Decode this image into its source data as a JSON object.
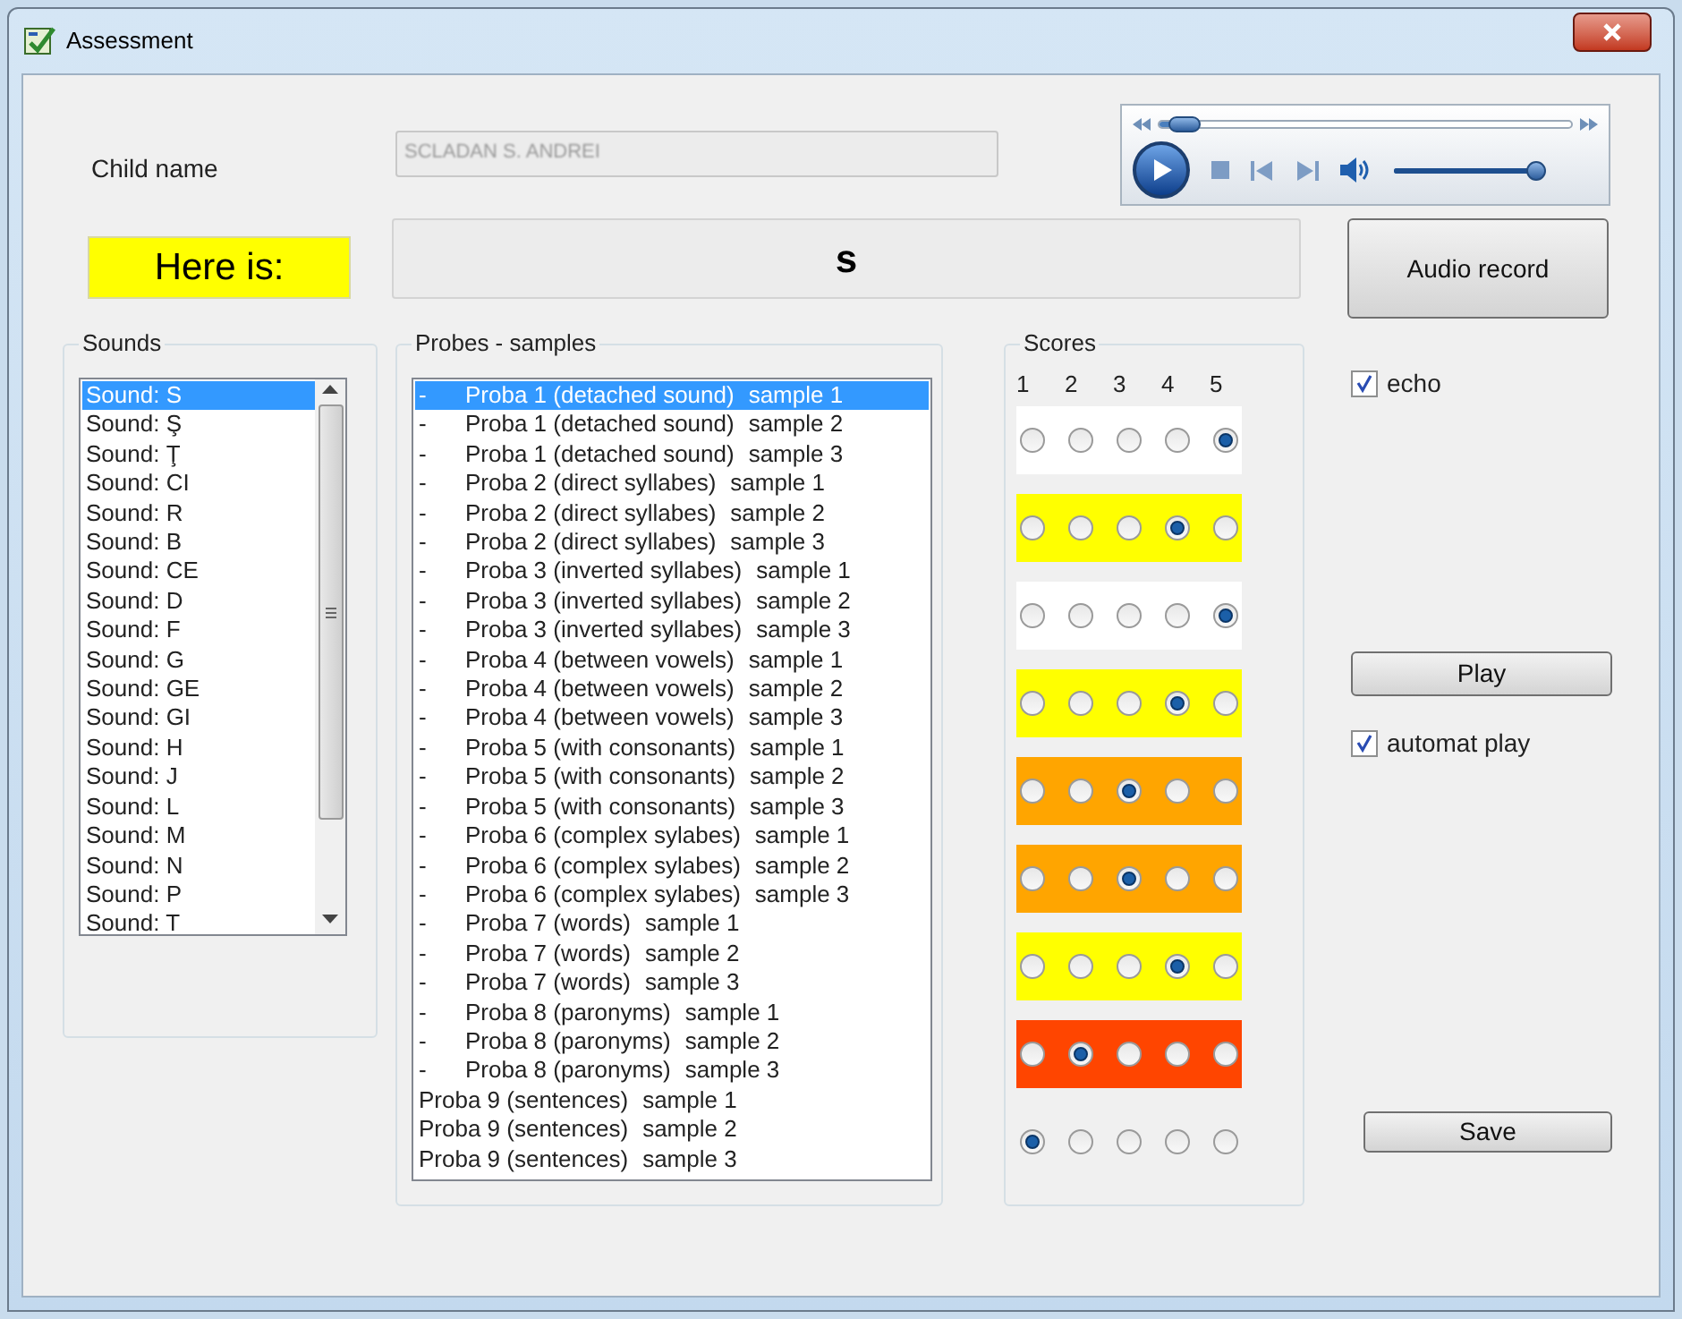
{
  "window": {
    "title": "Assessment"
  },
  "child_name": {
    "label": "Child name",
    "value": "SCLADAN S. ANDREI"
  },
  "player": {
    "seek": {
      "level": 0.03
    },
    "volume": {
      "level": 1.0
    }
  },
  "here_is": {
    "label": "Here is:",
    "value": "s"
  },
  "audio_record": "Audio record",
  "sounds": {
    "title": "Sounds",
    "items": [
      {
        "label": "Sound: S",
        "selected": true
      },
      {
        "label": "Sound: Ş",
        "selected": false
      },
      {
        "label": "Sound: Ţ",
        "selected": false
      },
      {
        "label": "Sound: CI",
        "selected": false
      },
      {
        "label": "Sound: R",
        "selected": false
      },
      {
        "label": "Sound: B",
        "selected": false
      },
      {
        "label": "Sound: CE",
        "selected": false
      },
      {
        "label": "Sound: D",
        "selected": false
      },
      {
        "label": "Sound: F",
        "selected": false
      },
      {
        "label": "Sound: G",
        "selected": false
      },
      {
        "label": "Sound: GE",
        "selected": false
      },
      {
        "label": "Sound: GI",
        "selected": false
      },
      {
        "label": "Sound: H",
        "selected": false
      },
      {
        "label": "Sound: J",
        "selected": false
      },
      {
        "label": "Sound: L",
        "selected": false
      },
      {
        "label": "Sound: M",
        "selected": false
      },
      {
        "label": "Sound: N",
        "selected": false
      },
      {
        "label": "Sound: P",
        "selected": false
      },
      {
        "label": "Sound: T",
        "selected": false
      }
    ]
  },
  "probes": {
    "title": "Probes - samples",
    "items": [
      {
        "dash": "-",
        "probe": "Proba 1 (detached sound)",
        "sample": "sample 1",
        "selected": true
      },
      {
        "dash": "-",
        "probe": "Proba 1 (detached sound)",
        "sample": "sample 2",
        "selected": false
      },
      {
        "dash": "-",
        "probe": "Proba 1 (detached sound)",
        "sample": "sample 3",
        "selected": false
      },
      {
        "dash": "-",
        "probe": "Proba 2 (direct syllabes)",
        "sample": "sample 1",
        "selected": false
      },
      {
        "dash": "-",
        "probe": "Proba 2 (direct syllabes)",
        "sample": "sample 2",
        "selected": false
      },
      {
        "dash": "-",
        "probe": "Proba 2 (direct syllabes)",
        "sample": "sample 3",
        "selected": false
      },
      {
        "dash": "-",
        "probe": "Proba 3 (inverted syllabes)",
        "sample": "sample 1",
        "selected": false
      },
      {
        "dash": "-",
        "probe": "Proba 3 (inverted syllabes)",
        "sample": "sample 2",
        "selected": false
      },
      {
        "dash": "-",
        "probe": "Proba 3 (inverted syllabes)",
        "sample": "sample 3",
        "selected": false
      },
      {
        "dash": "-",
        "probe": "Proba 4 (between vowels)",
        "sample": "sample 1",
        "selected": false
      },
      {
        "dash": "-",
        "probe": "Proba 4 (between vowels)",
        "sample": "sample 2",
        "selected": false
      },
      {
        "dash": "-",
        "probe": "Proba 4 (between vowels)",
        "sample": "sample 3",
        "selected": false
      },
      {
        "dash": "-",
        "probe": "Proba 5 (with consonants)",
        "sample": "sample 1",
        "selected": false
      },
      {
        "dash": "-",
        "probe": "Proba 5 (with consonants)",
        "sample": "sample 2",
        "selected": false
      },
      {
        "dash": "-",
        "probe": "Proba 5 (with consonants)",
        "sample": "sample 3",
        "selected": false
      },
      {
        "dash": "-",
        "probe": "Proba 6 (complex sylabes)",
        "sample": "sample 1",
        "selected": false
      },
      {
        "dash": "-",
        "probe": "Proba 6 (complex sylabes)",
        "sample": "sample 2",
        "selected": false
      },
      {
        "dash": "-",
        "probe": "Proba 6 (complex sylabes)",
        "sample": "sample 3",
        "selected": false
      },
      {
        "dash": "-",
        "probe": "Proba 7 (words)",
        "sample": "sample 1",
        "selected": false
      },
      {
        "dash": "-",
        "probe": "Proba 7 (words)",
        "sample": "sample 2",
        "selected": false
      },
      {
        "dash": "-",
        "probe": "Proba 7 (words)",
        "sample": "sample 3",
        "selected": false
      },
      {
        "dash": "-",
        "probe": "Proba 8 (paronyms)",
        "sample": "sample 1",
        "selected": false
      },
      {
        "dash": "-",
        "probe": "Proba 8 (paronyms)",
        "sample": "sample 2",
        "selected": false
      },
      {
        "dash": "-",
        "probe": "Proba 8 (paronyms)",
        "sample": "sample 3",
        "selected": false
      },
      {
        "probe": "Proba 9 (sentences)",
        "sample": "sample 1",
        "selected": false
      },
      {
        "probe": "Proba 9 (sentences)",
        "sample": "sample 2",
        "selected": false
      },
      {
        "probe": "Proba 9 (sentences)",
        "sample": "sample 3",
        "selected": false
      }
    ]
  },
  "scores": {
    "title": "Scores",
    "columns": [
      "1",
      "2",
      "3",
      "4",
      "5"
    ],
    "rows": [
      {
        "color": "#ffffff",
        "options": [
          {
            "selected": false
          },
          {
            "selected": false
          },
          {
            "selected": false
          },
          {
            "selected": false
          },
          {
            "selected": true
          }
        ]
      },
      {
        "color": "#ffff00",
        "options": [
          {
            "selected": false
          },
          {
            "selected": false
          },
          {
            "selected": false
          },
          {
            "selected": true
          },
          {
            "selected": false
          }
        ]
      },
      {
        "color": "#ffffff",
        "options": [
          {
            "selected": false
          },
          {
            "selected": false
          },
          {
            "selected": false
          },
          {
            "selected": false
          },
          {
            "selected": true
          }
        ]
      },
      {
        "color": "#ffff00",
        "options": [
          {
            "selected": false
          },
          {
            "selected": false
          },
          {
            "selected": false
          },
          {
            "selected": true
          },
          {
            "selected": false
          }
        ]
      },
      {
        "color": "#ffa500",
        "options": [
          {
            "selected": false
          },
          {
            "selected": false
          },
          {
            "selected": true
          },
          {
            "selected": false
          },
          {
            "selected": false
          }
        ]
      },
      {
        "color": "#ffa500",
        "options": [
          {
            "selected": false
          },
          {
            "selected": false
          },
          {
            "selected": true
          },
          {
            "selected": false
          },
          {
            "selected": false
          }
        ]
      },
      {
        "color": "#ffff00",
        "options": [
          {
            "selected": false
          },
          {
            "selected": false
          },
          {
            "selected": false
          },
          {
            "selected": true
          },
          {
            "selected": false
          }
        ]
      },
      {
        "color": "#ff4500",
        "options": [
          {
            "selected": false
          },
          {
            "selected": true
          },
          {
            "selected": false
          },
          {
            "selected": false
          },
          {
            "selected": false
          }
        ]
      },
      {
        "options": [
          {
            "selected": true
          },
          {
            "selected": false
          },
          {
            "selected": false
          },
          {
            "selected": false
          },
          {
            "selected": false
          }
        ]
      }
    ]
  },
  "echo": {
    "label": "echo",
    "checked": true
  },
  "play": "Play",
  "automat_play": {
    "label": "automat play",
    "checked": true
  },
  "save": "Save"
}
